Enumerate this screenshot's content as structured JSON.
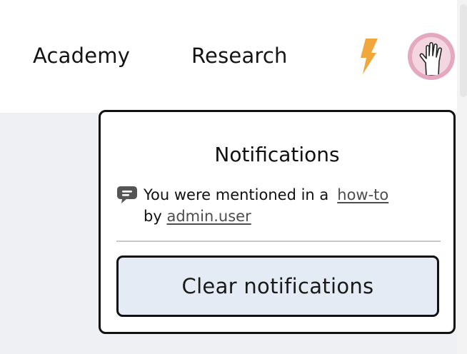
{
  "nav": {
    "academy_label": "Academy",
    "research_label": "Research"
  },
  "icons": {
    "bolt": "lightning-bolt-icon",
    "avatar": "raised-hand-avatar",
    "comment": "comment-icon"
  },
  "colors": {
    "bolt": "#f0a73c",
    "avatar_ring": "#e4a9bf",
    "avatar_fill": "#f4d6e1",
    "button_bg": "#e4ebf4"
  },
  "notifications": {
    "title": "Notifications",
    "items": [
      {
        "text_before": "You were mentioned in a",
        "link_label": "how-to",
        "text_by": "by",
        "user_label": "admin.user"
      }
    ],
    "clear_label": "Clear notifications"
  }
}
